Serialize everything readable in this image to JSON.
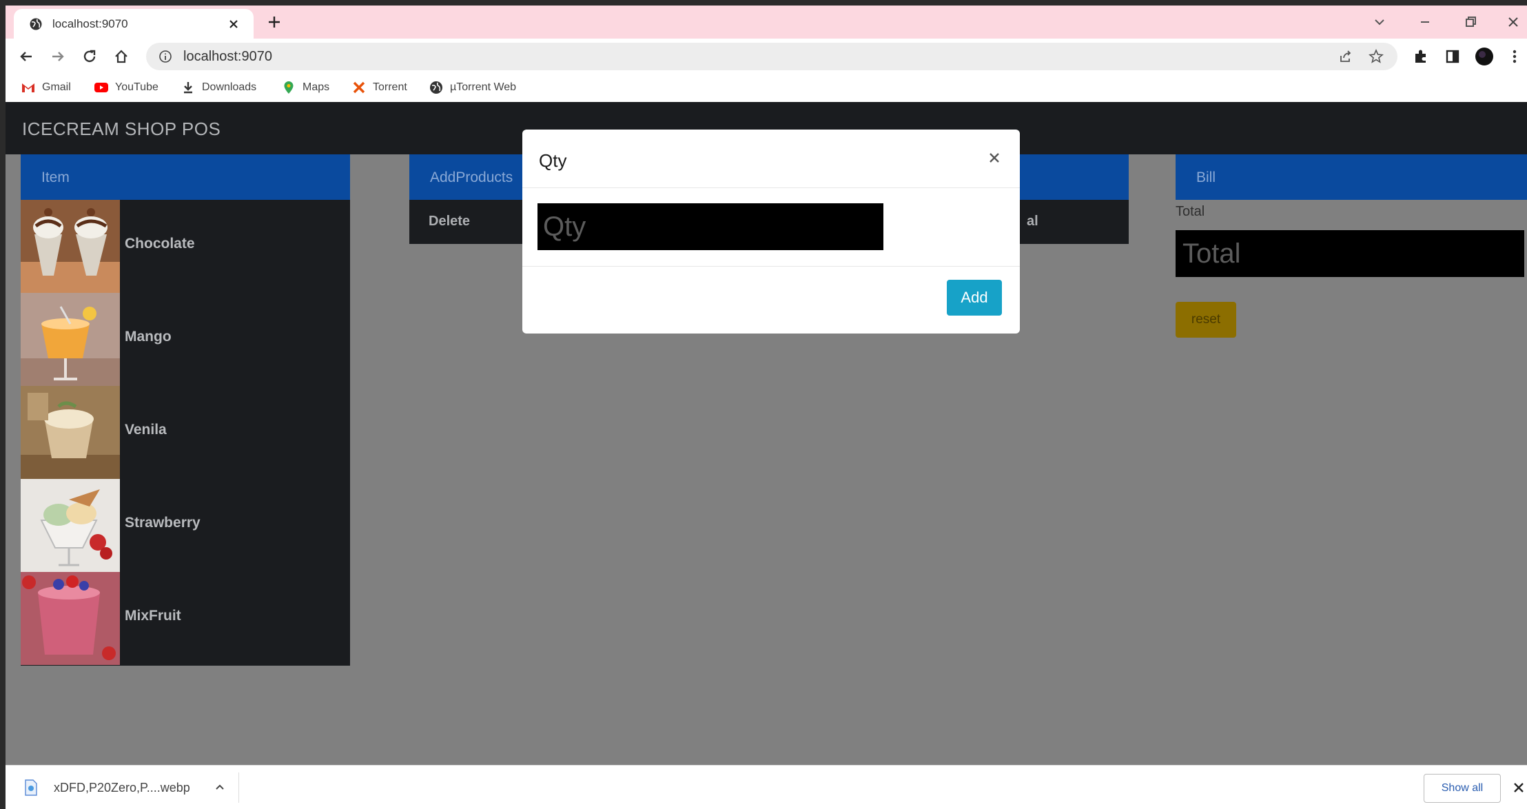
{
  "browser": {
    "tab_title": "localhost:9070",
    "url": "localhost:9070",
    "bookmarks": [
      "Gmail",
      "YouTube",
      "Downloads",
      "Maps",
      "Torrent",
      "µTorrent Web"
    ]
  },
  "app": {
    "brand": "ICECREAM SHOP POS",
    "items_header": "Item",
    "items": [
      {
        "name": "Chocolate"
      },
      {
        "name": "Mango"
      },
      {
        "name": "Venila"
      },
      {
        "name": "Strawberry"
      },
      {
        "name": "MixFruit"
      }
    ],
    "cart_header": "AddProducts",
    "cart_columns": [
      "Delete",
      "al"
    ],
    "bill": {
      "header": "Bill",
      "total_label": "Total",
      "total_placeholder": "Total",
      "reset_label": "reset"
    }
  },
  "modal": {
    "title": "Qty",
    "qty_placeholder": "Qty",
    "add_label": "Add"
  },
  "download": {
    "filename": "xDFD,P20Zero,P....webp",
    "show_all_label": "Show all"
  }
}
